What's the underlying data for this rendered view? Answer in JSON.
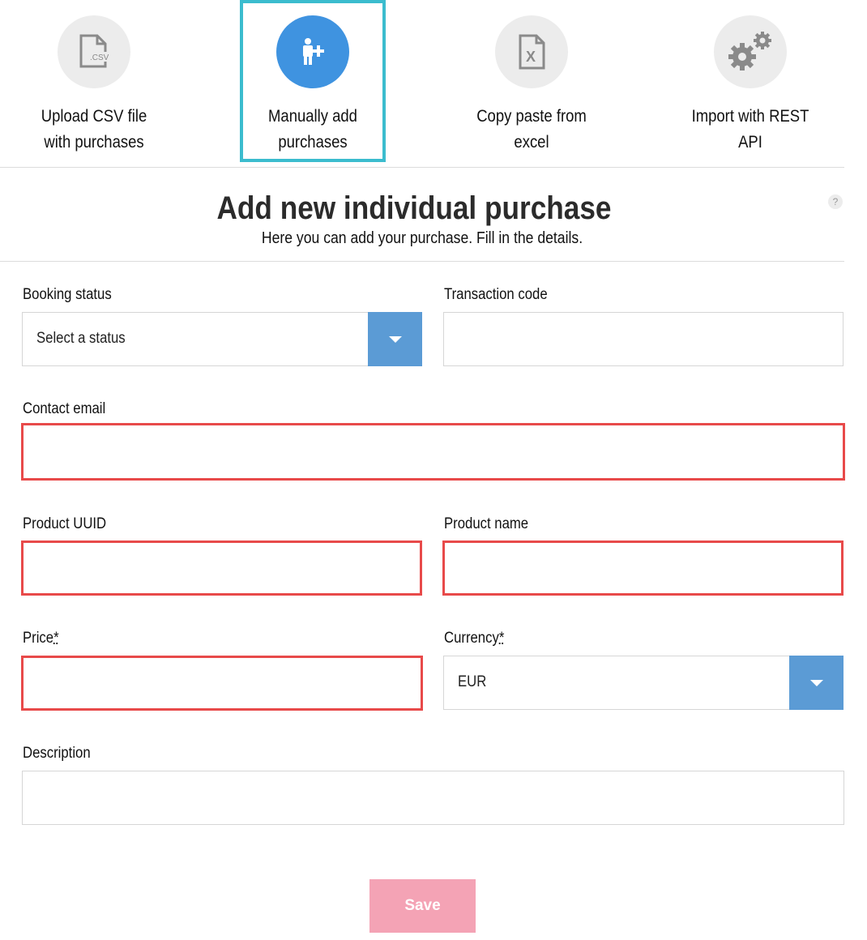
{
  "import_options": [
    {
      "label": "Upload CSV file with purchases",
      "icon": "csv-file-icon",
      "icon_text": ".CSV"
    },
    {
      "label": "Manually add purchases",
      "icon": "add-person-icon",
      "selected": true
    },
    {
      "label": "Copy paste from excel",
      "icon": "excel-file-icon",
      "icon_text": "X"
    },
    {
      "label": "Import with REST API",
      "icon": "gears-icon"
    }
  ],
  "header": {
    "title": "Add new individual purchase",
    "subtitle": "Here you can add your purchase. Fill in the details.",
    "help_icon": "?"
  },
  "form": {
    "booking_status": {
      "label": "Booking status",
      "value": "Select a status"
    },
    "transaction_code": {
      "label": "Transaction code",
      "value": ""
    },
    "contact_email": {
      "label": "Contact email",
      "value": ""
    },
    "product_uuid": {
      "label": "Product UUID",
      "value": ""
    },
    "product_name": {
      "label": "Product name",
      "value": ""
    },
    "price": {
      "label": "Price",
      "required_mark": "*",
      "value": ""
    },
    "currency": {
      "label": "Currency",
      "required_mark": "*",
      "value": "EUR"
    },
    "description": {
      "label": "Description",
      "value": ""
    }
  },
  "save_label": "Save",
  "colors": {
    "accent_blue": "#3f93e0",
    "select_arrow_blue": "#5b9bd5",
    "selected_border": "#3bbcce",
    "error_border": "#e84a4a",
    "save_button": "#f4a3b5"
  }
}
